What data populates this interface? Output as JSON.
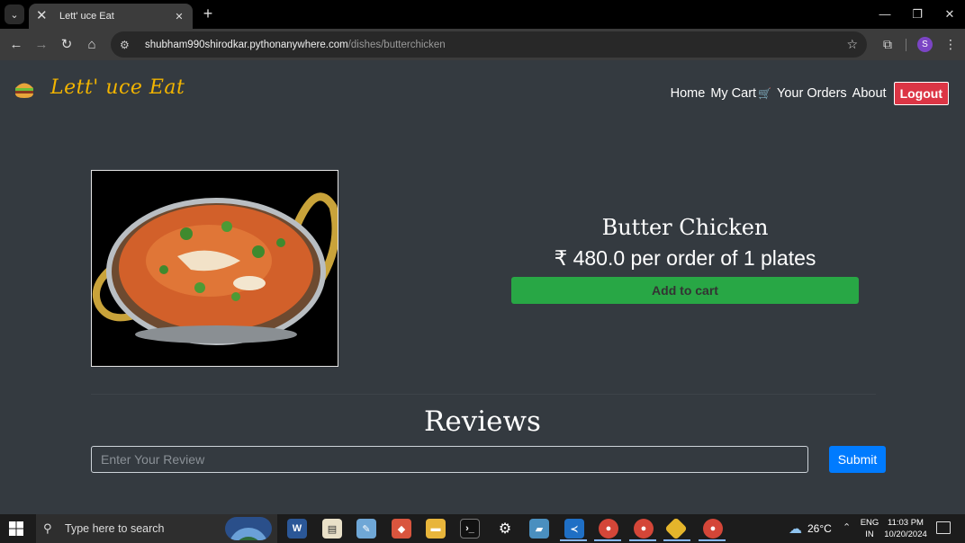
{
  "browser": {
    "tab_title": "Lett' uce Eat",
    "tab_close": "✕",
    "new_tab": "+",
    "url_host": "shubham990shirodkar.pythonanywhere.com",
    "url_path": "/dishes/butterchicken",
    "profile_initial": "S",
    "icons": [
      "tab-search-icon",
      "favicon-icon",
      "back-icon",
      "forward-icon",
      "reload-icon",
      "home-icon",
      "site-info-icon",
      "bookmark-star-icon",
      "extensions-icon",
      "menu-icon"
    ]
  },
  "site": {
    "brand": "Lett' uce Eat",
    "nav": {
      "home": "Home",
      "cart": "My Cart",
      "orders": "Your Orders",
      "about": "About",
      "logout": "Logout"
    },
    "colors": {
      "brand": "#f2b400",
      "logout": "#dc3545",
      "add_cart": "#28a745",
      "submit": "#007bff",
      "background": "#343a40"
    }
  },
  "dish": {
    "name": "Butter Chicken",
    "price_line": "₹ 480.0 per order of 1 plates",
    "add_to_cart": "Add to cart"
  },
  "reviews": {
    "title": "Reviews",
    "placeholder": "Enter Your Review",
    "submit": "Submit"
  },
  "taskbar": {
    "search_placeholder": "Type here to search",
    "temperature": "26°C",
    "lang_line1": "ENG",
    "lang_line2": "IN",
    "time": "11:03 PM",
    "date": "10/20/2024",
    "apps": [
      "word-icon",
      "file-explorer-doc-icon",
      "paint-icon",
      "paint3d-icon",
      "folder-icon",
      "terminal-icon",
      "settings-icon",
      "notes-icon",
      "vscode-icon",
      "chrome-icon",
      "chrome-icon",
      "git-icon",
      "chrome-icon"
    ]
  }
}
